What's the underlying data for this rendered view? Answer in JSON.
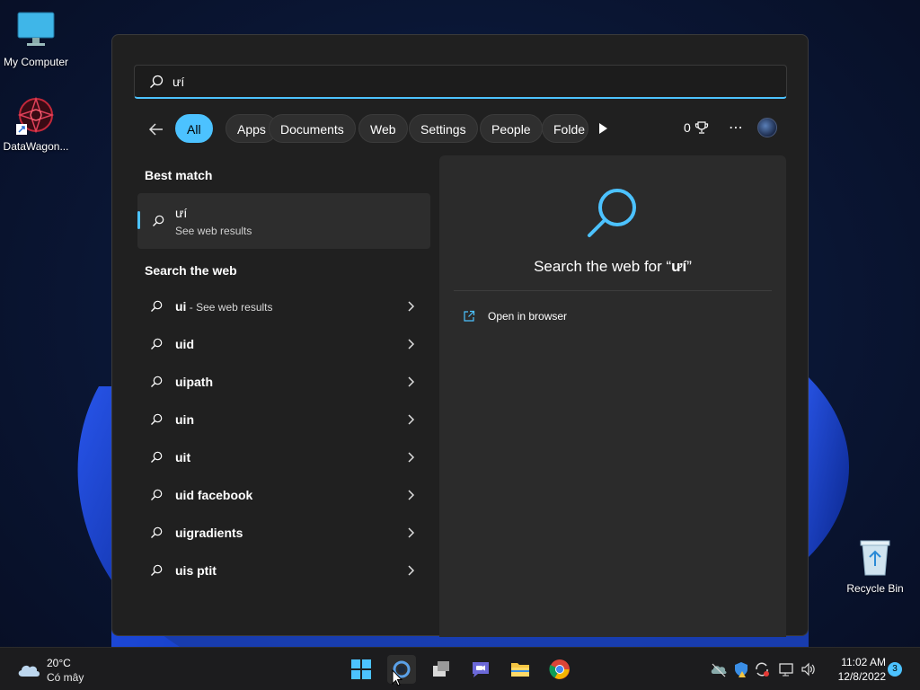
{
  "desktop": {
    "icons": [
      {
        "label": "My Computer",
        "icon": "computer-icon"
      },
      {
        "label": "DataWagon...",
        "icon": "datawagon-icon"
      },
      {
        "label": "Recycle Bin",
        "icon": "recycle-bin-icon"
      }
    ]
  },
  "search": {
    "query": "ưí",
    "placeholder": ""
  },
  "filters": {
    "items": [
      "All",
      "Apps",
      "Documents",
      "Web",
      "Settings",
      "People",
      "Folde"
    ],
    "active": "All",
    "points": "0"
  },
  "results": {
    "best_match_title": "Best match",
    "best_match": {
      "title": "ưí",
      "subtitle": "See web results"
    },
    "search_web_title": "Search the web",
    "web_items": [
      {
        "text": "ui",
        "suffix": " - See web results"
      },
      {
        "text": "uid",
        "suffix": ""
      },
      {
        "text": "uipath",
        "suffix": ""
      },
      {
        "text": "uin",
        "suffix": ""
      },
      {
        "text": "uit",
        "suffix": ""
      },
      {
        "text": "uid facebook",
        "suffix": ""
      },
      {
        "text": "uigradients",
        "suffix": ""
      },
      {
        "text": "uis ptit",
        "suffix": ""
      }
    ]
  },
  "preview": {
    "headline_prefix": "Search the web for “",
    "headline_query": "ưí",
    "headline_suffix": "”",
    "open_label": "Open in browser"
  },
  "taskbar": {
    "weather_temp": "20°C",
    "weather_desc": "Có mây",
    "apps": [
      "start-icon",
      "cortana-icon",
      "task-view-icon",
      "teams-chat-icon",
      "file-explorer-icon",
      "chrome-icon"
    ],
    "time": "11:02 AM",
    "date": "12/8/2022",
    "notifications": "3"
  },
  "colors": {
    "accent": "#4cc2ff",
    "panel_bg": "#202020",
    "preview_bg": "#2b2b2b",
    "taskbar_bg": "#1c1c1e"
  }
}
